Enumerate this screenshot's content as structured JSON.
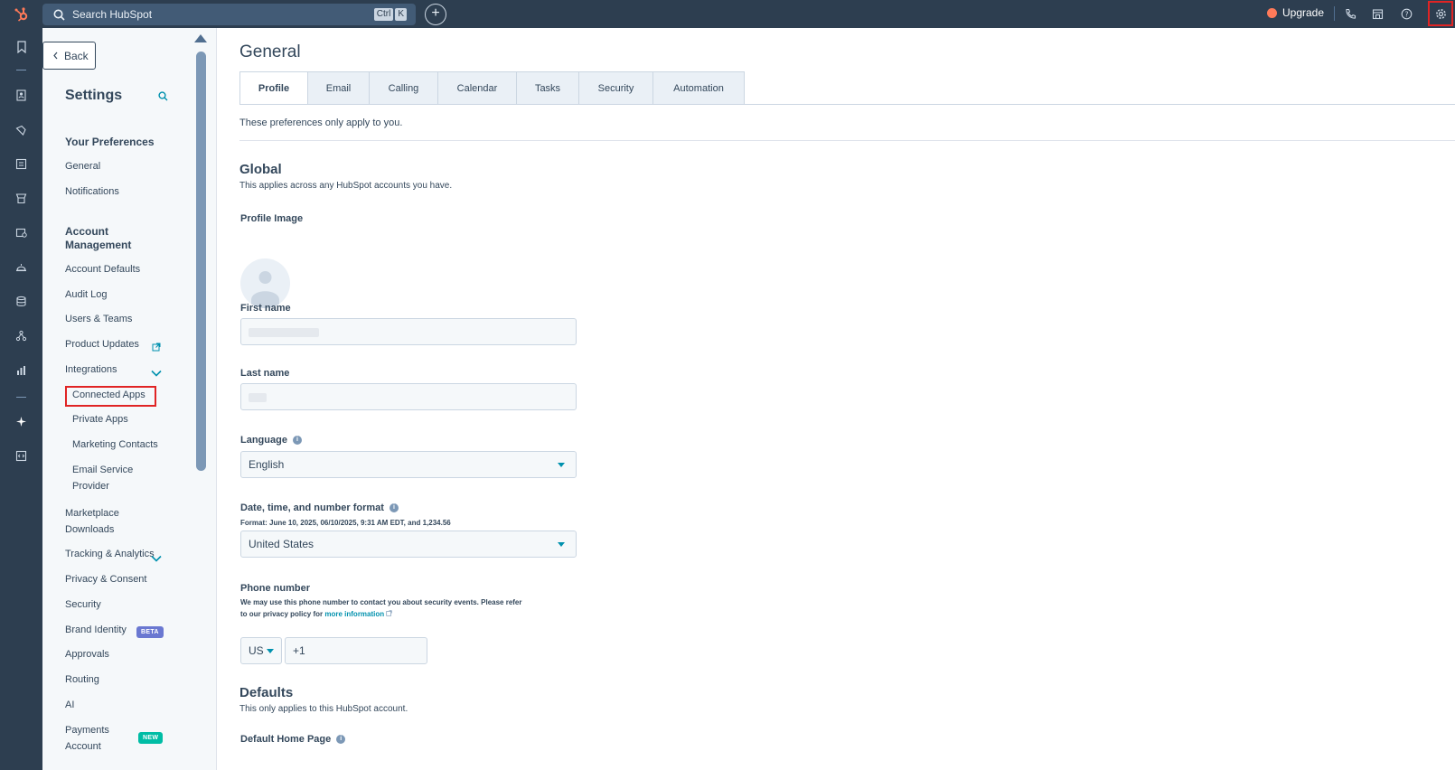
{
  "topbar": {
    "search_placeholder": "Search HubSpot",
    "kbd_ctrl": "Ctrl",
    "kbd_k": "K",
    "plus_label": "+",
    "upgrade_label": "Upgrade"
  },
  "sidebar": {
    "back_label": "Back",
    "title": "Settings",
    "your_preferences": "Your Preferences",
    "general": "General",
    "notifications": "Notifications",
    "account_management": "Account Management",
    "account_defaults": "Account Defaults",
    "audit_log": "Audit Log",
    "users_teams": "Users & Teams",
    "product_updates": "Product Updates",
    "integrations": "Integrations",
    "connected_apps": "Connected Apps",
    "private_apps": "Private Apps",
    "marketing_contacts": "Marketing Contacts",
    "email_service_provider": "Email Service Provider",
    "marketplace_downloads": "Marketplace Downloads",
    "tracking_analytics": "Tracking & Analytics",
    "privacy_consent": "Privacy & Consent",
    "security": "Security",
    "brand_identity": "Brand Identity",
    "beta_badge": "BETA",
    "approvals": "Approvals",
    "routing": "Routing",
    "ai": "AI",
    "payments_account": "Payments Account",
    "new_badge": "NEW"
  },
  "main": {
    "title": "General",
    "tabs": [
      "Profile",
      "Email",
      "Calling",
      "Calendar",
      "Tasks",
      "Security",
      "Automation"
    ],
    "intro": "These preferences only apply to you.",
    "global_heading": "Global",
    "global_desc": "This applies across any HubSpot accounts you have.",
    "profile_image_label": "Profile Image",
    "first_name_label": "First name",
    "last_name_label": "Last name",
    "language_label": "Language",
    "language_value": "English",
    "format_label": "Date, time, and number format",
    "format_help": "Format: June 10, 2025, 06/10/2025, 9:31 AM EDT, and 1,234.56",
    "format_value": "United States",
    "phone_label": "Phone number",
    "phone_help_1": "We may use this phone number to contact you about security events. Please refer",
    "phone_help_2": "to our privacy policy for",
    "phone_help_link": "more information",
    "phone_country": "US",
    "phone_value": "+1",
    "defaults_heading": "Defaults",
    "defaults_desc": "This only applies to this HubSpot account.",
    "default_home_label": "Default Home Page"
  },
  "colors": {
    "nav_dark": "#2d3e50",
    "accent_teal": "#0091ae",
    "hubspot_orange": "#ff7a59",
    "highlight_red": "#e02424"
  }
}
